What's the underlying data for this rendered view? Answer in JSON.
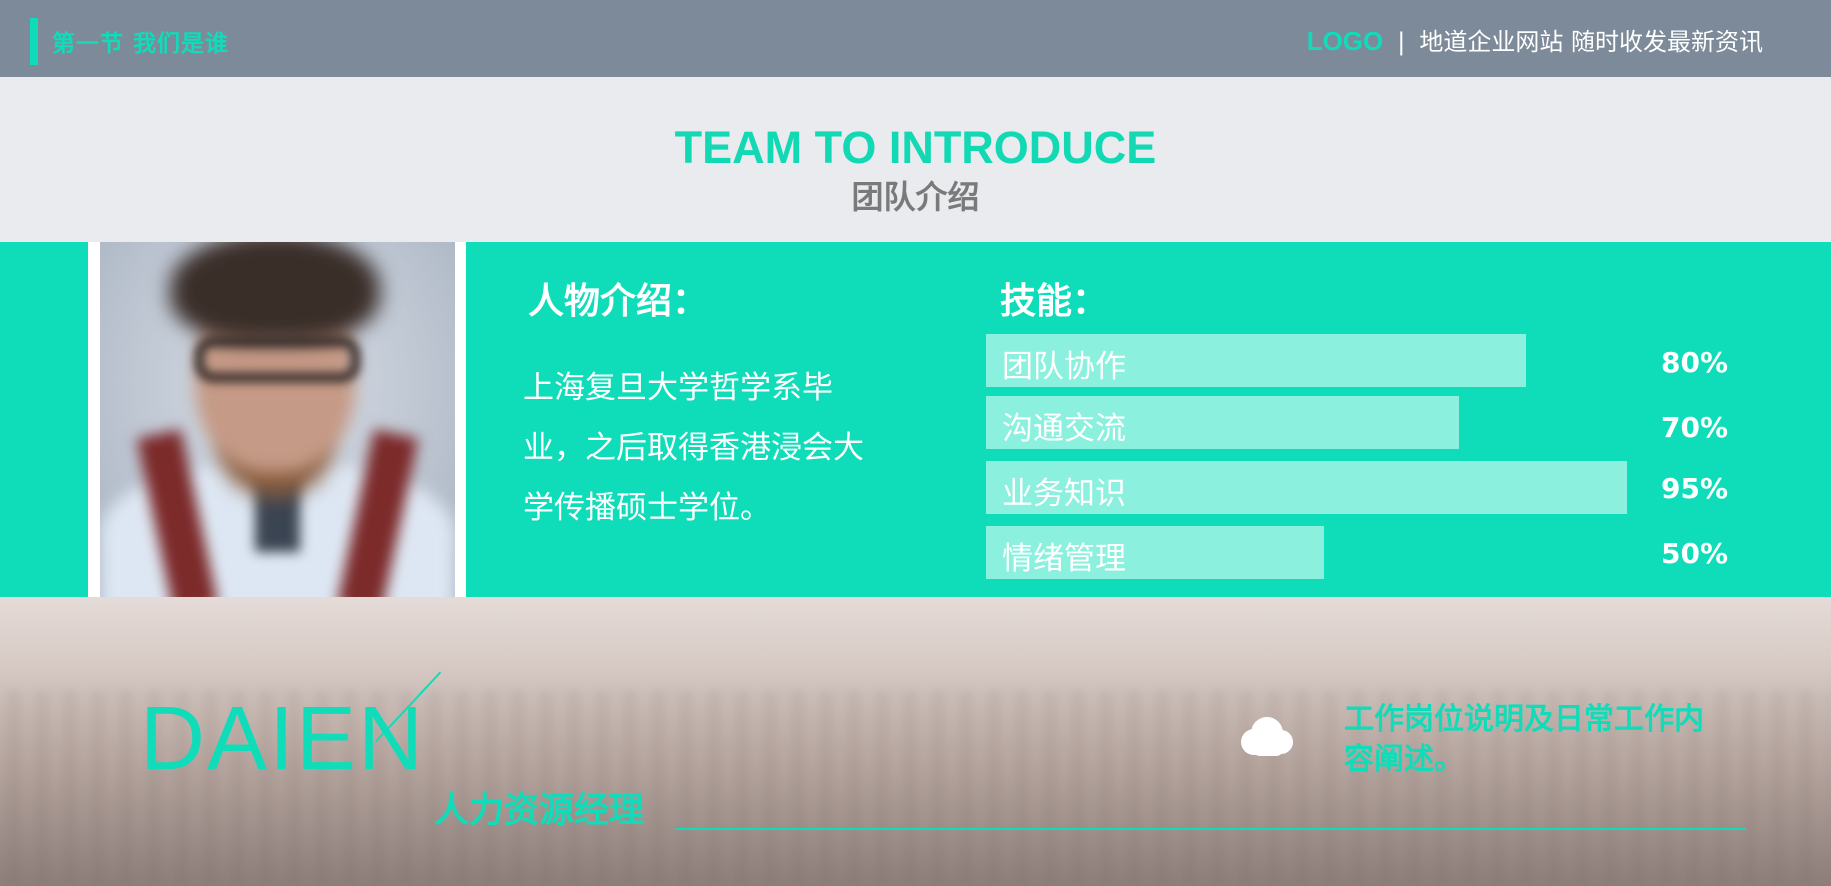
{
  "topbar": {
    "section_title": "第一节  我们是谁",
    "logo": "LOGO",
    "separator": "|",
    "tagline": "地道企业网站 随时收发最新资讯"
  },
  "header": {
    "title": "TEAM TO INTRODUCE",
    "subtitle": "团队介绍"
  },
  "profile": {
    "intro_title": "人物介绍：",
    "intro_text": "上海复旦大学哲学系毕业，之后取得香港浸会大学传播硕士学位。",
    "skills_title": "技能：",
    "skills": [
      {
        "name": "团队协作",
        "value": 80,
        "label": "80%"
      },
      {
        "name": "沟通交流",
        "value": 70,
        "label": "70%"
      },
      {
        "name": "业务知识",
        "value": 95,
        "label": "95%"
      },
      {
        "name": "情绪管理",
        "value": 50,
        "label": "50%"
      }
    ]
  },
  "footer": {
    "name": "DAIEN",
    "role": "人力资源经理",
    "description": "工作岗位说明及日常工作内容阐述。"
  },
  "colors": {
    "accent": "#0fdcb9",
    "bar_fill": "#8bf0dd",
    "topbar": "#7d8a99"
  },
  "icons": {
    "photo": "portrait-photo",
    "cloud": "cloud-icon"
  }
}
